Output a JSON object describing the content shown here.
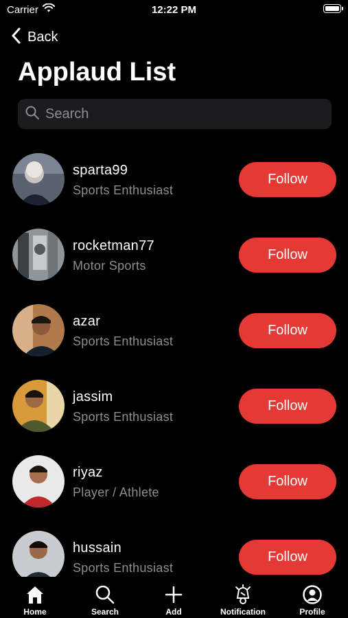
{
  "status_bar": {
    "carrier": "Carrier",
    "time": "12:22 PM"
  },
  "nav": {
    "back_label": "Back",
    "title": "Applaud List"
  },
  "search": {
    "placeholder": "Search"
  },
  "users": [
    {
      "username": "sparta99",
      "role": "Sports Enthusiast",
      "button": "Follow"
    },
    {
      "username": "rocketman77",
      "role": "Motor Sports",
      "button": "Follow"
    },
    {
      "username": "azar",
      "role": "Sports Enthusiast",
      "button": "Follow"
    },
    {
      "username": "jassim",
      "role": "Sports Enthusiast",
      "button": "Follow"
    },
    {
      "username": "riyaz",
      "role": "Player / Athlete",
      "button": "Follow"
    },
    {
      "username": "hussain",
      "role": "Sports Enthusiast",
      "button": "Follow"
    }
  ],
  "tabbar": {
    "tabs": [
      {
        "label": "Home",
        "icon": "home-icon"
      },
      {
        "label": "Search",
        "icon": "search-icon"
      },
      {
        "label": "Add",
        "icon": "plus-icon"
      },
      {
        "label": "Notification",
        "icon": "notification-icon"
      },
      {
        "label": "Profile",
        "icon": "profile-icon"
      }
    ]
  },
  "colors": {
    "accent": "#e53935",
    "background": "#000000",
    "muted_text": "#8e8e93",
    "search_bg": "#1c1c1e"
  }
}
